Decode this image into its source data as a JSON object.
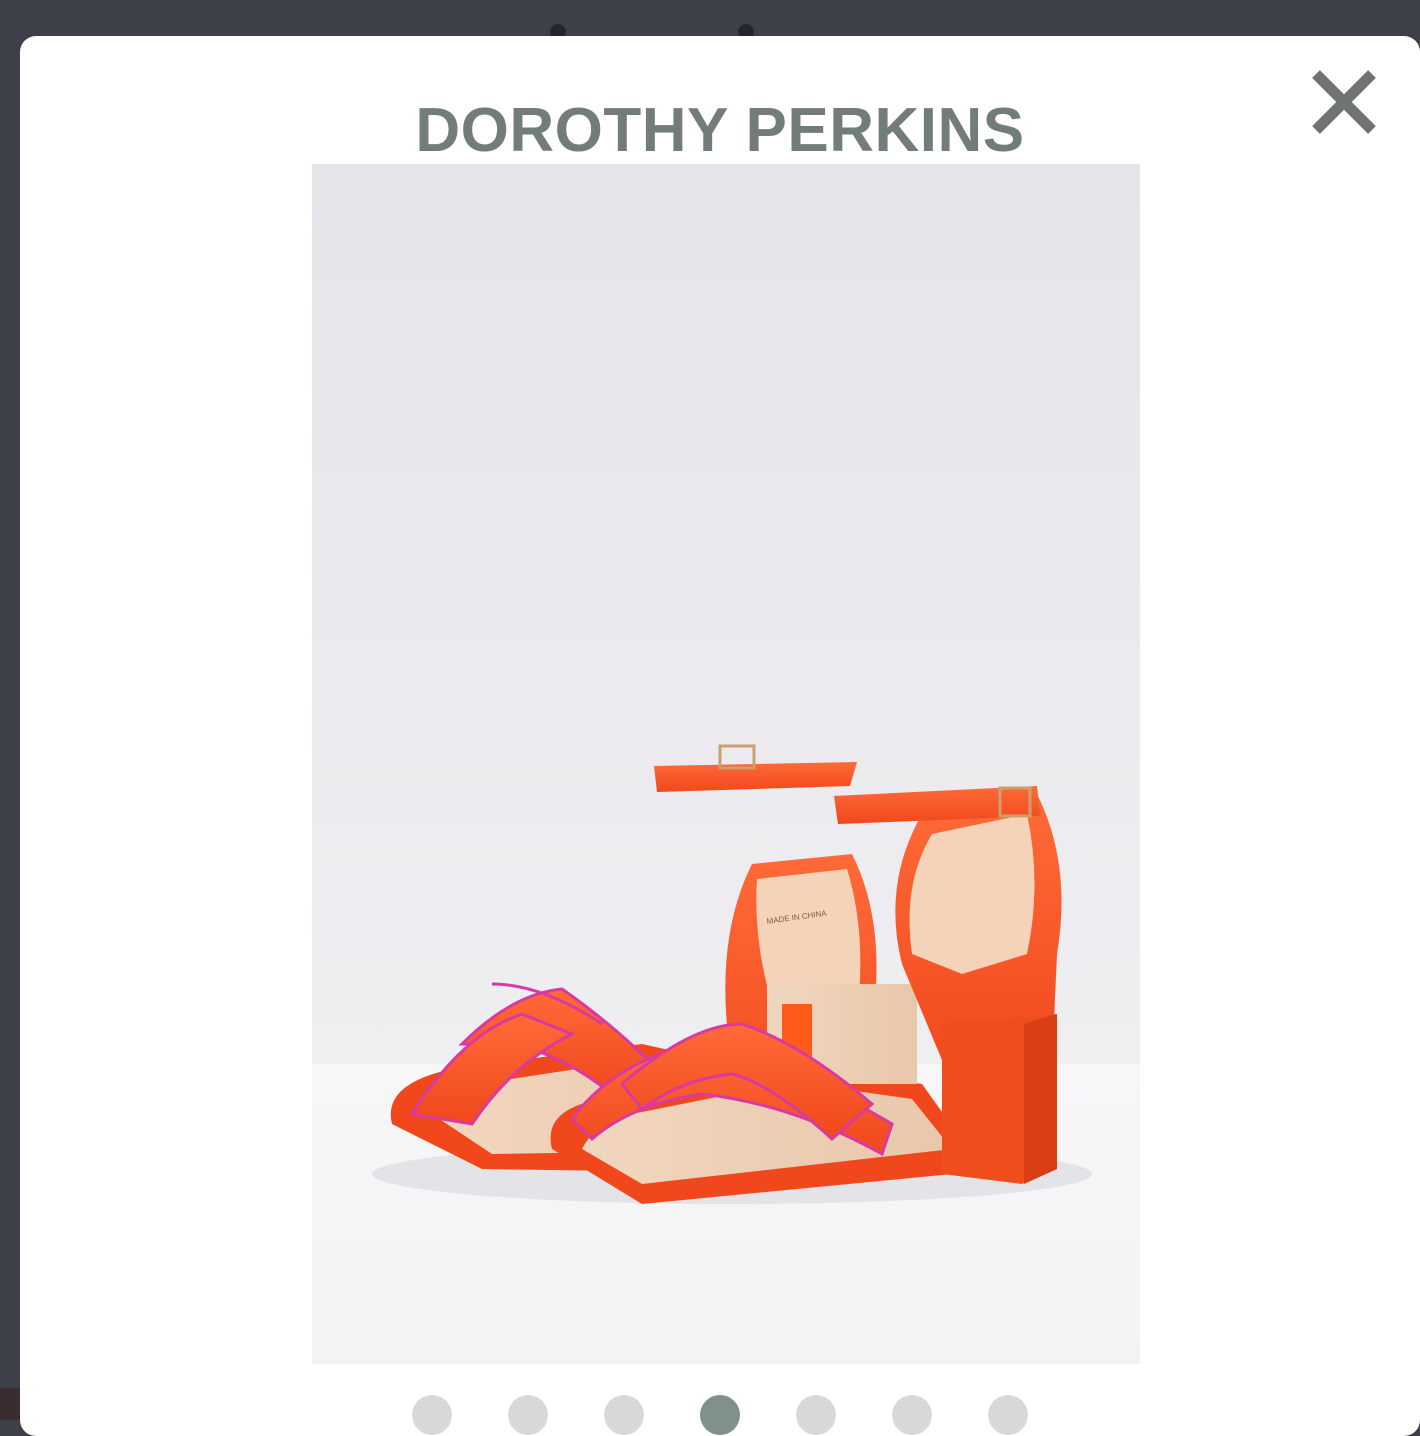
{
  "modal": {
    "brand": "DOROTHY PERKINS",
    "close_icon": "close-icon",
    "accent_color": "#7f918a",
    "title_color": "#727d78"
  },
  "product_image": {
    "subject": "orange block-heel ankle-strap sandals",
    "label_text": "MADE IN CHINA"
  },
  "gallery": {
    "total_images": 7,
    "active_index": 3
  }
}
